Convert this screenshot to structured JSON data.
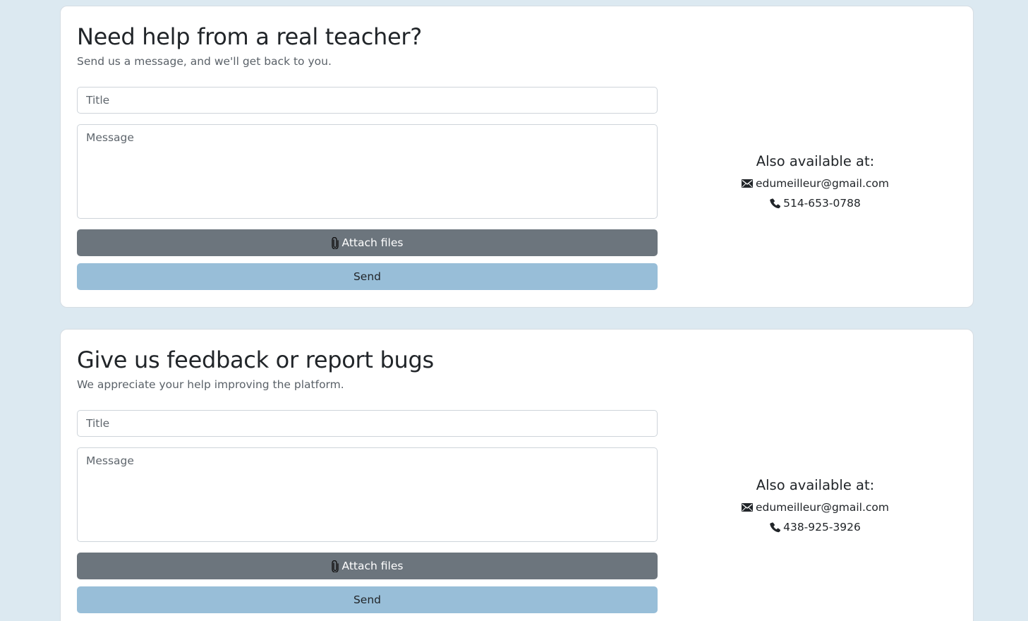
{
  "help_card": {
    "heading": "Need help from a real teacher?",
    "subheading": "Send us a message, and we'll get back to you.",
    "title_placeholder": "Title",
    "message_placeholder": "Message",
    "attach_label": "Attach files",
    "send_label": "Send",
    "contact": {
      "heading": "Also available at:",
      "email": "edumeilleur@gmail.com",
      "phone": "514-653-0788"
    }
  },
  "feedback_card": {
    "heading": "Give us feedback or report bugs",
    "subheading": "We appreciate your help improving the platform.",
    "title_placeholder": "Title",
    "message_placeholder": "Message",
    "attach_label": "Attach files",
    "send_label": "Send",
    "contact": {
      "heading": "Also available at:",
      "email": "edumeilleur@gmail.com",
      "phone": "438-925-3926"
    }
  },
  "colors": {
    "page_background": "#dce9f1",
    "attach_button": "#6c757d",
    "send_button": "#98bed8"
  },
  "icons": {
    "attach": "paperclip-icon",
    "email": "envelope-icon",
    "phone": "phone-icon"
  }
}
